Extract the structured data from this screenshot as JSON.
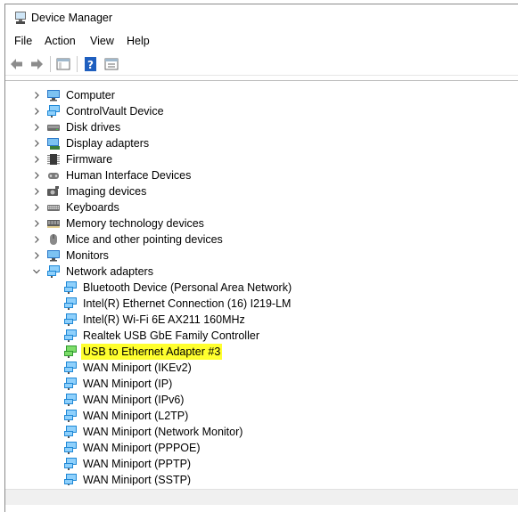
{
  "window": {
    "title": "Device Manager"
  },
  "menu": [
    "File",
    "Action",
    "View",
    "Help"
  ],
  "toolbar": [
    "back-arrow-icon",
    "forward-arrow-icon",
    "show-hide-console-tree-icon",
    "help-icon",
    "properties-icon"
  ],
  "tree": {
    "categories": [
      {
        "label": "Computer",
        "icon": "computer-icon",
        "expanded": false
      },
      {
        "label": "ControlVault Device",
        "icon": "network-icon",
        "expanded": false
      },
      {
        "label": "Disk drives",
        "icon": "disk-drive-icon",
        "expanded": false
      },
      {
        "label": "Display adapters",
        "icon": "display-adapter-icon",
        "expanded": false
      },
      {
        "label": "Firmware",
        "icon": "firmware-icon",
        "expanded": false
      },
      {
        "label": "Human Interface Devices",
        "icon": "hid-icon",
        "expanded": false
      },
      {
        "label": "Imaging devices",
        "icon": "camera-icon",
        "expanded": false
      },
      {
        "label": "Keyboards",
        "icon": "keyboard-icon",
        "expanded": false
      },
      {
        "label": "Memory technology devices",
        "icon": "memory-icon",
        "expanded": false
      },
      {
        "label": "Mice and other pointing devices",
        "icon": "mouse-icon",
        "expanded": false
      },
      {
        "label": "Monitors",
        "icon": "monitor-icon",
        "expanded": false
      },
      {
        "label": "Network adapters",
        "icon": "network-adapter-icon",
        "expanded": true
      }
    ],
    "network_adapters": [
      {
        "label": "Bluetooth Device (Personal Area Network)",
        "highlighted": false
      },
      {
        "label": "Intel(R) Ethernet Connection (16) I219-LM",
        "highlighted": false
      },
      {
        "label": "Intel(R) Wi-Fi 6E AX211 160MHz",
        "highlighted": false
      },
      {
        "label": "Realtek USB GbE Family Controller",
        "highlighted": false
      },
      {
        "label": "USB to Ethernet Adapter #3",
        "highlighted": true
      },
      {
        "label": "WAN Miniport (IKEv2)",
        "highlighted": false
      },
      {
        "label": "WAN Miniport (IP)",
        "highlighted": false
      },
      {
        "label": "WAN Miniport (IPv6)",
        "highlighted": false
      },
      {
        "label": "WAN Miniport (L2TP)",
        "highlighted": false
      },
      {
        "label": "WAN Miniport (Network Monitor)",
        "highlighted": false
      },
      {
        "label": "WAN Miniport (PPPOE)",
        "highlighted": false
      },
      {
        "label": "WAN Miniport (PPTP)",
        "highlighted": false
      },
      {
        "label": "WAN Miniport (SSTP)",
        "highlighted": false
      }
    ]
  },
  "colors": {
    "highlight": "#ffff2e",
    "network_icon": "#1e88d6",
    "adapter_green": "#3dbb3d"
  }
}
